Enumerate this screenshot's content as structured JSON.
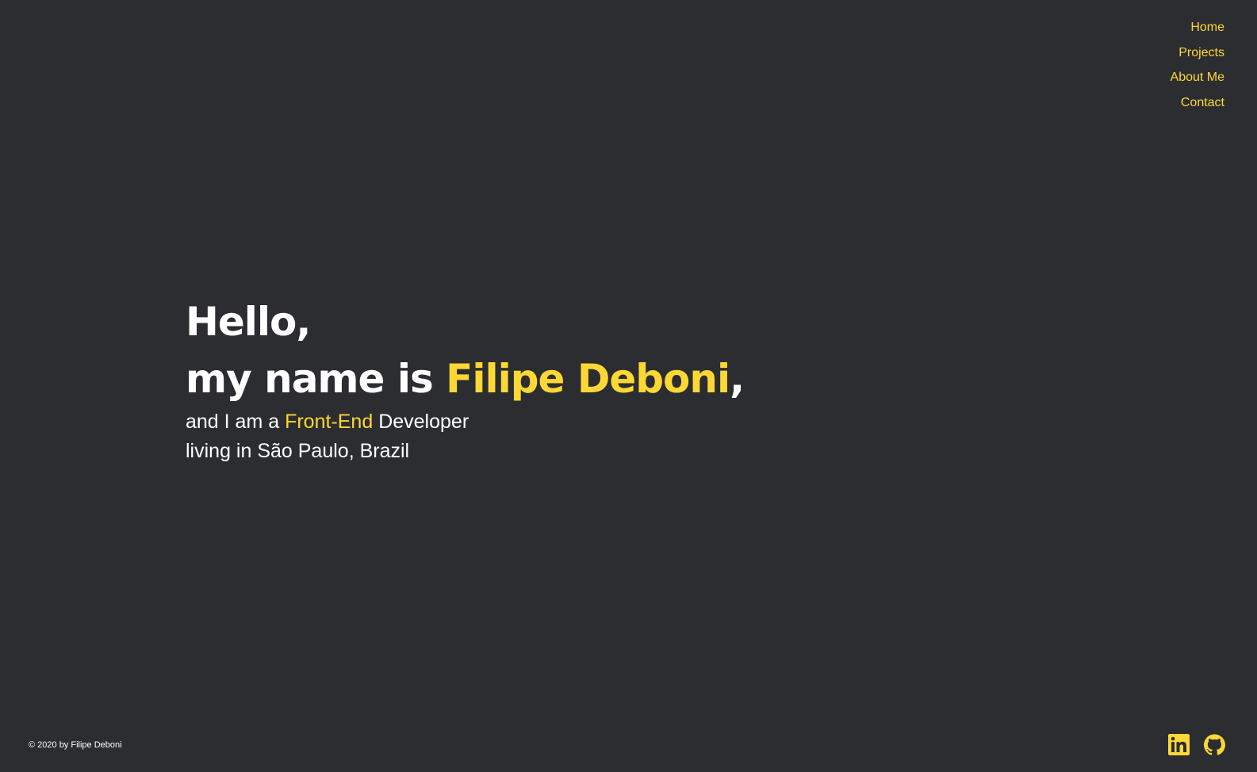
{
  "nav": {
    "items": [
      {
        "label": "Home"
      },
      {
        "label": "Projects"
      },
      {
        "label": "About Me"
      },
      {
        "label": "Contact"
      }
    ]
  },
  "hero": {
    "line1": "Hello,",
    "line2_prefix": "my name is ",
    "name": "Filipe Deboni",
    "line2_suffix": ",",
    "line3_prefix": "and I am a ",
    "role": "Front-End",
    "line3_suffix": " Developer",
    "line4": "living in São Paulo, Brazil"
  },
  "footer": {
    "copyright": "© 2020 by Filipe Deboni",
    "social": [
      {
        "icon": "linkedin-icon"
      },
      {
        "icon": "github-icon"
      }
    ]
  },
  "colors": {
    "background": "#2c2d30",
    "accent": "#fdd835",
    "text": "#ffffff"
  }
}
